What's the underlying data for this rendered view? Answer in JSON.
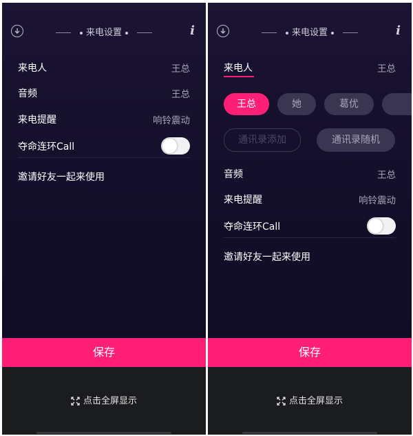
{
  "header": {
    "title": "来电设置"
  },
  "rows": {
    "caller_label": "来电人",
    "caller_value": "王总",
    "audio_label": "音频",
    "audio_value": "王总",
    "reminder_label": "来电提醒",
    "reminder_value": "响铃震动",
    "call_label": "夺命连环Call",
    "invite_label": "邀请好友一起来使用"
  },
  "callers": [
    "王总",
    "她",
    "葛优"
  ],
  "contact_buttons": {
    "add": "通讯录添加",
    "random": "通讯录随机"
  },
  "save_label": "保存",
  "fullscreen_label": "点击全屏显示",
  "colors": {
    "accent": "#ff1f77",
    "background": "#140f2a",
    "bottom_bar": "#1b1c1e"
  },
  "toggle_on": true
}
